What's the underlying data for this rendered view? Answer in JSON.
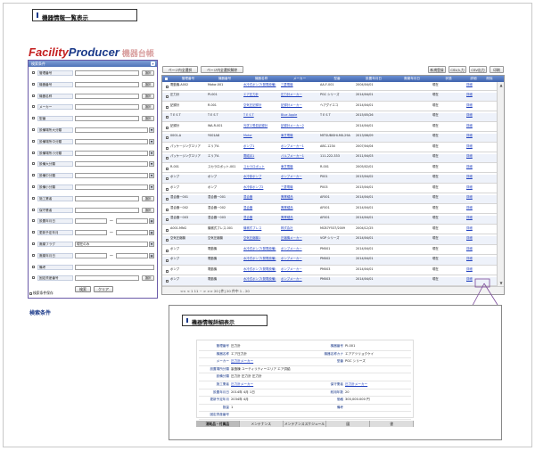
{
  "list_title": "機器情報一覧表示",
  "detail_title": "機器情報詳細表示",
  "logo": {
    "part1": "Facility",
    "part2": "Producer",
    "part3": "機器台帳"
  },
  "search_panel": {
    "header": "検索条件",
    "fields": [
      {
        "label": "管理番号",
        "button": "選択"
      },
      {
        "label": "機器番号",
        "button": "選択"
      },
      {
        "label": "機器名称",
        "button": "選択"
      },
      {
        "label": "メーカー",
        "button": "選択"
      },
      {
        "label": "型番",
        "button": "選択"
      },
      {
        "label": "設備場所大分類"
      },
      {
        "label": "設備場所中分類"
      },
      {
        "label": "設備場所小分類"
      },
      {
        "label": "設備大分類"
      },
      {
        "label": "設備中分類"
      },
      {
        "label": "設備小分類"
      },
      {
        "label": "施工業者",
        "button": "選択"
      },
      {
        "label": "保守業者",
        "button": "選択"
      },
      {
        "label": "設置年月日",
        "range": "〜"
      },
      {
        "label": "更新予定年月",
        "range": "〜"
      },
      {
        "label": "廃棄フラグ",
        "value": "現在のみ"
      },
      {
        "label": "廃棄年月日",
        "range": "〜"
      },
      {
        "label": "備考"
      },
      {
        "label": "固定資産番号",
        "button": "選択"
      }
    ],
    "search_button": "検索",
    "clear_button": "クリア",
    "save_condition_label": "検索条件保存"
  },
  "caption_search": "検索条件",
  "toolbar": {
    "select_all": "ページ内全選択",
    "deselect_all": "ページ内全選択解除",
    "new": "新規登録",
    "csv_in": "CSV入力",
    "csv_out": "CSV出力",
    "print": "印刷"
  },
  "grid": {
    "columns": [
      "",
      "管理番号",
      "機器番号",
      "機器名称",
      "メーカー",
      "型番",
      "設置年月日",
      "廃棄年月日",
      "状態",
      "詳細",
      "削除"
    ],
    "rows": [
      [
        "電動機-A002",
        "Motor-001",
        "水冷式ポンプ(発電設備)",
        "三菱電機",
        "AA-F-001",
        "2004/04/01",
        "",
        "現在",
        "詳細"
      ],
      [
        "圧力計",
        "PI-001",
        "エア圧力計",
        "圧力計メーカー",
        "PGC シリーズ",
        "2014/04/01",
        "",
        "現在",
        "詳細"
      ],
      [
        "記録計",
        "R-001",
        "空気圧記録計",
        "記録計メーカー",
        "ヘアグイエコ",
        "2014/04/01",
        "",
        "現在",
        "詳細"
      ],
      [
        "T E S T",
        "T E S T",
        "T E S T",
        "Blue Apple",
        "T E S T",
        "2015/05/26",
        "",
        "現在",
        "詳細"
      ],
      [
        "記録計",
        "WA-R-001",
        "光学エ受皿記録計",
        "記録計メーカー2",
        "",
        "2014/04/01",
        "",
        "現在",
        "詳細"
      ],
      [
        "0001-A",
        "Y001A8",
        "Motor",
        "東芝電機",
        "MITSUBISHI-MX-29A",
        "2013/06/09",
        "",
        "現在",
        "詳細"
      ],
      [
        "パッケージングエリア",
        "エリアA",
        "ポンプ1",
        "ポンプメーカー1",
        "ABC-1234",
        "2007/04/04",
        "",
        "現在",
        "詳細"
      ],
      [
        "パッケージングエリア",
        "エリアA",
        "電磁弁1",
        "バルブメーカー1",
        "111-222-333",
        "2011/04/03",
        "",
        "現在",
        "詳細"
      ],
      [
        "R-001",
        "スカラロボット-001",
        "スカラロボット",
        "東芝電機",
        "R-001",
        "2005/02/01",
        "",
        "現在",
        "詳細"
      ],
      [
        "ポンプ",
        "ポンプ",
        "水冷却ポンプ",
        "ポンプメーカー",
        "P001",
        "2015/04/02",
        "",
        "現在",
        "詳細"
      ],
      [
        "ポンプ",
        "ポンプ",
        "水冷却ポンプ2",
        "三菱電機",
        "P003",
        "2015/04/01",
        "",
        "現在",
        "詳細"
      ],
      [
        "混合器ー001",
        "混合器ー001",
        "混合器",
        "異業種品",
        "AF001",
        "2014/04/01",
        "",
        "現在",
        "詳細"
      ],
      [
        "混合器ー002",
        "混合器ー002",
        "混合器",
        "異業種品",
        "AF001",
        "2014/04/01",
        "",
        "現在",
        "詳細"
      ],
      [
        "混合器ー003",
        "混合器ー003",
        "混合器",
        "異業種品",
        "AF001",
        "2014/04/01",
        "",
        "現在",
        "詳細"
      ],
      [
        "A001-MNG",
        "機械式プレス-001",
        "機械式プレス",
        "株式会社",
        "MCB7Y537/2009",
        "2004/12/25",
        "",
        "現在",
        "詳細"
      ],
      [
        "空気圧縮機",
        "空気圧縮機",
        "空気圧縮機1",
        "圧縮機メーカー",
        "VGP シリーズ",
        "2014/04/01",
        "",
        "現在",
        "詳細"
      ],
      [
        "ポンプ",
        "電動機",
        "水冷式ポンプ(発電設備)",
        "ポンプメーカー",
        "PM001",
        "2014/04/01",
        "",
        "現在",
        "詳細"
      ],
      [
        "ポンプ",
        "電動機",
        "水冷式ポンプ(発電設備)",
        "ポンプメーカー",
        "PM002",
        "2014/04/01",
        "",
        "現在",
        "詳細"
      ],
      [
        "ポンプ",
        "電動機",
        "水冷式ポンプ(発電設備)",
        "ポンプメーカー",
        "PM003",
        "2014/04/01",
        "",
        "現在",
        "詳細"
      ],
      [
        "ポンプ",
        "電動機",
        "水冷式ポンプ(発電設備)",
        "ポンプメーカー",
        "PM003",
        "2014/04/01",
        "",
        "現在",
        "詳細"
      ]
    ],
    "pager": "<< < 1    11 ~ > >>  20  [件]  20 件中 1 - 20"
  },
  "detail": {
    "left": [
      {
        "k": "管理番号",
        "v": "圧力計"
      },
      {
        "k": "機器名称",
        "v": "エア圧力計"
      },
      {
        "k": "メーカー",
        "v": "圧力計メーカー",
        "link": true
      },
      {
        "k": "設置場所分類",
        "v": "製造棟  ユーティリティーエリア  エア供給"
      },
      {
        "k": "設備分類",
        "v": "圧力計  圧力計  圧力計"
      },
      {
        "k": "施工業者",
        "v": "圧力計メーカー",
        "link": true
      },
      {
        "k": "設置年月日",
        "v": "2014年 4月 1日"
      },
      {
        "k": "更新予定年月",
        "v": "2034年 4月"
      },
      {
        "k": "数量",
        "v": "1"
      },
      {
        "k": "固定資産番号",
        "v": ""
      }
    ],
    "right": [
      {
        "k": "機器番号",
        "v": "PI-001"
      },
      {
        "k": "機器名称カナ",
        "v": "エアアツリョクケイ"
      },
      {
        "k": "型番",
        "v": "PGC シリーズ"
      },
      {
        "k": "保守業者",
        "v": "圧力計メーカー",
        "link": true
      },
      {
        "k": "耐用年数",
        "v": "20"
      },
      {
        "k": "価格",
        "v": "300,000.000 円"
      },
      {
        "k": "備考",
        "v": ""
      }
    ],
    "tabs": [
      "消耗品・付属品",
      "メンテナンス",
      "メンテナンススケジュール",
      "図",
      "書"
    ]
  }
}
